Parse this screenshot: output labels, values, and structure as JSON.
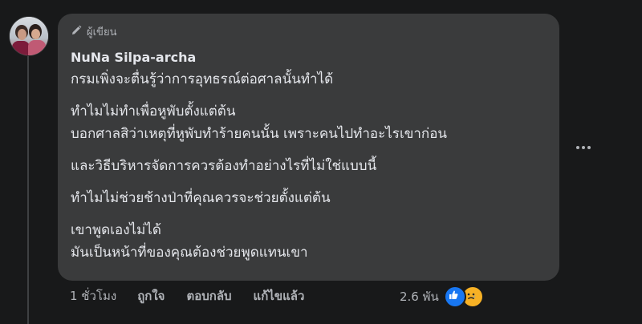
{
  "author": {
    "badge_label": "ผู้เขียน",
    "name": "NuNa Silpa-archa"
  },
  "comment": {
    "paragraphs": [
      [
        "กรมเพิ่งจะตื่นรู้ว่าการอุทธรณ์ต่อศาลนั้นทำได้"
      ],
      [
        "ทำไมไม่ทำเพื่อหูพับตั้งแต่ต้น",
        "บอกศาลสิว่าเหตุที่หูพับทำร้ายคนนั้น เพราะคนไปทำอะไรเขาก่อน"
      ],
      [
        "และวิธีบริหารจัดการควรต้องทำอย่างไรที่ไม่ใช่แบบนี้"
      ],
      [
        "ทำไมไม่ช่วยช้างป่าที่คุณควรจะช่วยตั้งแต่ต้น"
      ],
      [
        "เขาพูดเองไม่ได้",
        "มันเป็นหน้าที่ของคุณต้องช่วยพูดแทนเขา"
      ]
    ]
  },
  "actions": {
    "time": "1 ชั่วโมง",
    "like": "ถูกใจ",
    "reply": "ตอบกลับ",
    "edited": "แก้ไขแล้ว"
  },
  "reactions": {
    "count": "2.6 พัน",
    "icons": [
      "like-icon",
      "sad-icon"
    ]
  },
  "colors": {
    "background": "#18191a",
    "bubble": "#3a3b3c",
    "text": "#e4e6eb",
    "secondary": "#b0b3b8",
    "like_blue": "#1877f2",
    "sad_yellow": "#f7b125"
  }
}
